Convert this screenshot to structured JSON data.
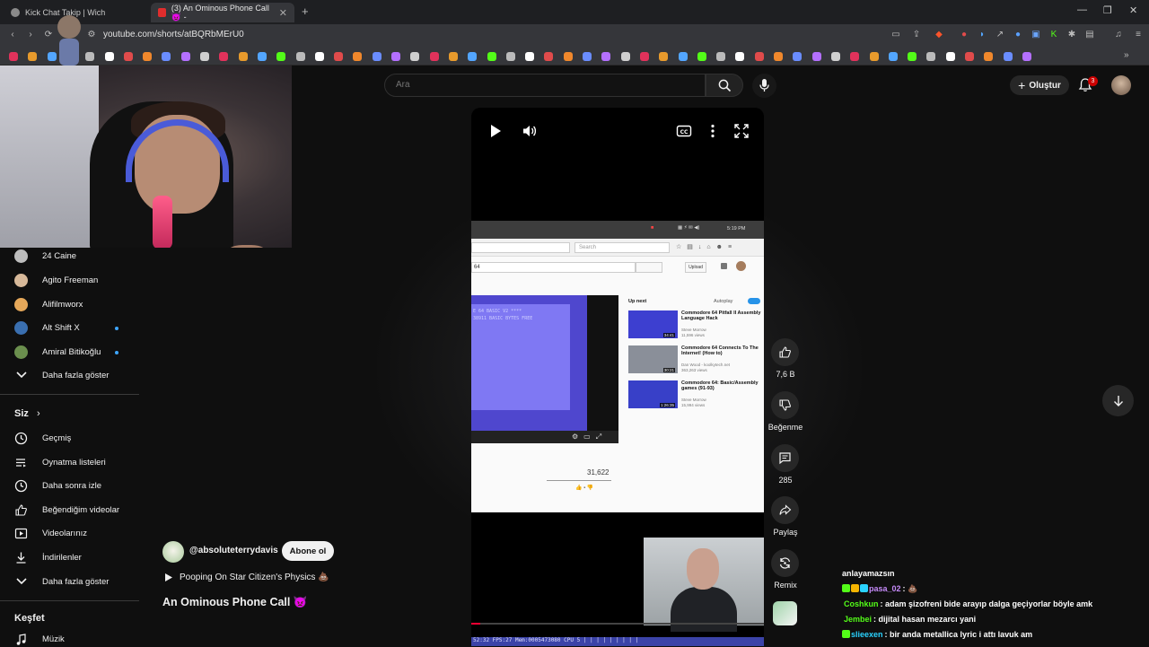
{
  "browser": {
    "tabs": [
      {
        "label": "Kick Chat Takip | Wich",
        "active": false
      },
      {
        "label": "(3) An Ominous Phone Call 👿 -",
        "active": true
      }
    ],
    "new_tab_label": "+",
    "url": "youtube.com/shorts/atBQRbMErU0"
  },
  "header": {
    "search_placeholder": "Ara",
    "create_label": "Oluştur",
    "notification_count": "3"
  },
  "sidebar": {
    "subscriptions": [
      {
        "label": "24 Caine",
        "avatar_color": "#bdbdbd",
        "new": false
      },
      {
        "label": "Agito Freeman",
        "avatar_color": "#d7b99a",
        "new": false
      },
      {
        "label": "Alifilmworx",
        "avatar_color": "#e6a85a",
        "new": false
      },
      {
        "label": "Alt Shift X",
        "avatar_color": "#3a6fb0",
        "new": true
      },
      {
        "label": "Amiral Bitikoğlu",
        "avatar_color": "#6b8f4e",
        "new": true
      }
    ],
    "show_more_1": "Daha fazla göster",
    "you_title": "Siz",
    "you_items": [
      {
        "label": "Geçmiş",
        "icon": "history-icon"
      },
      {
        "label": "Oynatma listeleri",
        "icon": "playlists-icon"
      },
      {
        "label": "Daha sonra izle",
        "icon": "watch-later-icon"
      },
      {
        "label": "Beğendiğim videolar",
        "icon": "liked-videos-icon"
      },
      {
        "label": "Videolarınız",
        "icon": "your-videos-icon"
      },
      {
        "label": "İndirilenler",
        "icon": "downloads-icon"
      }
    ],
    "show_more_2": "Daha fazla göster",
    "explore_title": "Keşfet",
    "explore_items": [
      {
        "label": "Müzik",
        "icon": "music-icon"
      }
    ]
  },
  "video": {
    "inner": {
      "clock": "5:19 PM",
      "search_placeholder": "Search",
      "address_fragment": "64",
      "upload_label": "Upload",
      "up_next": "Up next",
      "autoplay": "Autoplay",
      "c64_line1": "E 64 BASIC V2 ****",
      "c64_line2": "38911 BASIC BYTES FREE",
      "views": "31,622",
      "recommended": [
        {
          "title": "Commodore 64 Pitfall II Assembly Language Hack",
          "channel": "Steve Morrow",
          "views": "11,596 views",
          "duration": "34:41",
          "color": "#3d3fd0"
        },
        {
          "title": "Commodore 64 Connects To The Internet! (How to)",
          "channel": "Dan Wood - koolkytech.net",
          "views": "363,263 views",
          "duration": "30:21",
          "color": "#8a8f99"
        },
        {
          "title": "Commodore 64: Basic/Assembly games (91-93)",
          "channel": "Steve Morrow",
          "views": "15,994 views",
          "duration": "1:26:35",
          "color": "#3840c8"
        }
      ]
    },
    "bottom_text": "52:32 FPS:27 Mem:0005473080 CPU 5 | | | | | | | | |",
    "progress": 0.03
  },
  "actions": {
    "like_count": "7,6 B",
    "dislike_label": "Beğenme",
    "comment_count": "285",
    "share_label": "Paylaş",
    "remix_label": "Remix"
  },
  "channel": {
    "handle": "@absoluteterrydavis",
    "subscribe_label": "Abone ol",
    "audio_title": "Pooping On Star Citizen's Physics 💩",
    "short_title": "An Ominous Phone Call 👿"
  },
  "chat": {
    "lines": [
      {
        "user": "",
        "user_color": "#ffffff",
        "message": "anlayamazsın",
        "badges": []
      },
      {
        "user": "pasa_02",
        "user_color": "#c58af9",
        "message": ": 💩",
        "badges": [
          "#53fc18",
          "#f5b400",
          "#2ad3ff"
        ]
      },
      {
        "user": "Coshkun",
        "user_color": "#53fc18",
        "message": ": adam şizofreni bide arayıp dalga geçiyorlar böyle amk",
        "badges": []
      },
      {
        "user": "Jembei",
        "user_color": "#53fc18",
        "message": ": dijital hasan mezarcı yani",
        "badges": []
      },
      {
        "user": "slieexen",
        "user_color": "#2ad3ff",
        "message": ": bir anda metallica lyric i attı lavuk am",
        "badges": [
          "#53fc18"
        ]
      }
    ]
  }
}
